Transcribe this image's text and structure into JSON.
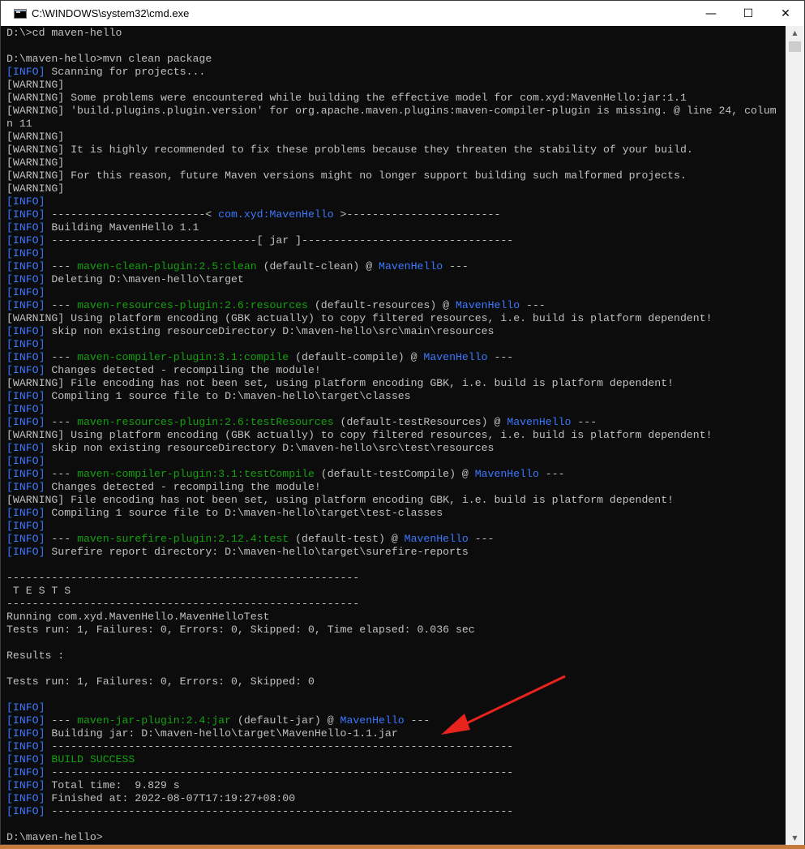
{
  "window": {
    "title": "C:\\WINDOWS\\system32\\cmd.exe",
    "controls": {
      "minimize": "—",
      "maximize": "☐",
      "close": "✕"
    }
  },
  "colors": {
    "info": "#3b78ff",
    "green": "#13a10e",
    "text": "#c0c0c0",
    "arrow": "#e8231e"
  },
  "console": {
    "lines": [
      [
        {
          "t": "D:\\>cd maven-hello"
        }
      ],
      [
        {
          "t": ""
        }
      ],
      [
        {
          "t": "D:\\maven-hello>mvn clean package"
        }
      ],
      [
        {
          "t": "[INFO]",
          "c": "info"
        },
        {
          "t": " Scanning for projects..."
        }
      ],
      [
        {
          "t": "[WARNING]"
        }
      ],
      [
        {
          "t": "[WARNING]"
        },
        {
          "t": " Some problems were encountered while building the effective model for com.xyd:MavenHello:jar:1.1"
        }
      ],
      [
        {
          "t": "[WARNING]"
        },
        {
          "t": " 'build.plugins.plugin.version' for org.apache.maven.plugins:maven-compiler-plugin is missing. @ line 24, colum"
        }
      ],
      [
        {
          "t": "n 11"
        }
      ],
      [
        {
          "t": "[WARNING]"
        }
      ],
      [
        {
          "t": "[WARNING]"
        },
        {
          "t": " It is highly recommended to fix these problems because they threaten the stability of your build."
        }
      ],
      [
        {
          "t": "[WARNING]"
        }
      ],
      [
        {
          "t": "[WARNING]"
        },
        {
          "t": " For this reason, future Maven versions might no longer support building such malformed projects."
        }
      ],
      [
        {
          "t": "[WARNING]"
        }
      ],
      [
        {
          "t": "[INFO]",
          "c": "info"
        }
      ],
      [
        {
          "t": "[INFO]",
          "c": "info"
        },
        {
          "t": " ------------------------< "
        },
        {
          "t": "com.xyd:MavenHello",
          "c": "blue"
        },
        {
          "t": " >------------------------"
        }
      ],
      [
        {
          "t": "[INFO]",
          "c": "info"
        },
        {
          "t": " Building MavenHello 1.1"
        }
      ],
      [
        {
          "t": "[INFO]",
          "c": "info"
        },
        {
          "t": " --------------------------------[ jar ]---------------------------------"
        }
      ],
      [
        {
          "t": "[INFO]",
          "c": "info"
        }
      ],
      [
        {
          "t": "[INFO]",
          "c": "info"
        },
        {
          "t": " --- "
        },
        {
          "t": "maven-clean-plugin:2.5:clean",
          "c": "green"
        },
        {
          "t": " (default-clean) @ "
        },
        {
          "t": "MavenHello",
          "c": "blue"
        },
        {
          "t": " ---"
        }
      ],
      [
        {
          "t": "[INFO]",
          "c": "info"
        },
        {
          "t": " Deleting D:\\maven-hello\\target"
        }
      ],
      [
        {
          "t": "[INFO]",
          "c": "info"
        }
      ],
      [
        {
          "t": "[INFO]",
          "c": "info"
        },
        {
          "t": " --- "
        },
        {
          "t": "maven-resources-plugin:2.6:resources",
          "c": "green"
        },
        {
          "t": " (default-resources) @ "
        },
        {
          "t": "MavenHello",
          "c": "blue"
        },
        {
          "t": " ---"
        }
      ],
      [
        {
          "t": "[WARNING]"
        },
        {
          "t": " Using platform encoding (GBK actually) to copy filtered resources, i.e. build is platform dependent!"
        }
      ],
      [
        {
          "t": "[INFO]",
          "c": "info"
        },
        {
          "t": " skip non existing resourceDirectory D:\\maven-hello\\src\\main\\resources"
        }
      ],
      [
        {
          "t": "[INFO]",
          "c": "info"
        }
      ],
      [
        {
          "t": "[INFO]",
          "c": "info"
        },
        {
          "t": " --- "
        },
        {
          "t": "maven-compiler-plugin:3.1:compile",
          "c": "green"
        },
        {
          "t": " (default-compile) @ "
        },
        {
          "t": "MavenHello",
          "c": "blue"
        },
        {
          "t": " ---"
        }
      ],
      [
        {
          "t": "[INFO]",
          "c": "info"
        },
        {
          "t": " Changes detected - recompiling the module!"
        }
      ],
      [
        {
          "t": "[WARNING]"
        },
        {
          "t": " File encoding has not been set, using platform encoding GBK, i.e. build is platform dependent!"
        }
      ],
      [
        {
          "t": "[INFO]",
          "c": "info"
        },
        {
          "t": " Compiling 1 source file to D:\\maven-hello\\target\\classes"
        }
      ],
      [
        {
          "t": "[INFO]",
          "c": "info"
        }
      ],
      [
        {
          "t": "[INFO]",
          "c": "info"
        },
        {
          "t": " --- "
        },
        {
          "t": "maven-resources-plugin:2.6:testResources",
          "c": "green"
        },
        {
          "t": " (default-testResources) @ "
        },
        {
          "t": "MavenHello",
          "c": "blue"
        },
        {
          "t": " ---"
        }
      ],
      [
        {
          "t": "[WARNING]"
        },
        {
          "t": " Using platform encoding (GBK actually) to copy filtered resources, i.e. build is platform dependent!"
        }
      ],
      [
        {
          "t": "[INFO]",
          "c": "info"
        },
        {
          "t": " skip non existing resourceDirectory D:\\maven-hello\\src\\test\\resources"
        }
      ],
      [
        {
          "t": "[INFO]",
          "c": "info"
        }
      ],
      [
        {
          "t": "[INFO]",
          "c": "info"
        },
        {
          "t": " --- "
        },
        {
          "t": "maven-compiler-plugin:3.1:testCompile",
          "c": "green"
        },
        {
          "t": " (default-testCompile) @ "
        },
        {
          "t": "MavenHello",
          "c": "blue"
        },
        {
          "t": " ---"
        }
      ],
      [
        {
          "t": "[INFO]",
          "c": "info"
        },
        {
          "t": " Changes detected - recompiling the module!"
        }
      ],
      [
        {
          "t": "[WARNING]"
        },
        {
          "t": " File encoding has not been set, using platform encoding GBK, i.e. build is platform dependent!"
        }
      ],
      [
        {
          "t": "[INFO]",
          "c": "info"
        },
        {
          "t": " Compiling 1 source file to D:\\maven-hello\\target\\test-classes"
        }
      ],
      [
        {
          "t": "[INFO]",
          "c": "info"
        }
      ],
      [
        {
          "t": "[INFO]",
          "c": "info"
        },
        {
          "t": " --- "
        },
        {
          "t": "maven-surefire-plugin:2.12.4:test",
          "c": "green"
        },
        {
          "t": " (default-test) @ "
        },
        {
          "t": "MavenHello",
          "c": "blue"
        },
        {
          "t": " ---"
        }
      ],
      [
        {
          "t": "[INFO]",
          "c": "info"
        },
        {
          "t": " Surefire report directory: D:\\maven-hello\\target\\surefire-reports"
        }
      ],
      [
        {
          "t": ""
        }
      ],
      [
        {
          "t": "-------------------------------------------------------"
        }
      ],
      [
        {
          "t": " T E S T S"
        }
      ],
      [
        {
          "t": "-------------------------------------------------------"
        }
      ],
      [
        {
          "t": "Running com.xyd.MavenHello.MavenHelloTest"
        }
      ],
      [
        {
          "t": "Tests run: 1, Failures: 0, Errors: 0, Skipped: 0, Time elapsed: 0.036 sec"
        }
      ],
      [
        {
          "t": ""
        }
      ],
      [
        {
          "t": "Results :"
        }
      ],
      [
        {
          "t": ""
        }
      ],
      [
        {
          "t": "Tests run: 1, Failures: 0, Errors: 0, Skipped: 0"
        }
      ],
      [
        {
          "t": ""
        }
      ],
      [
        {
          "t": "[INFO]",
          "c": "info"
        }
      ],
      [
        {
          "t": "[INFO]",
          "c": "info"
        },
        {
          "t": " --- "
        },
        {
          "t": "maven-jar-plugin:2.4:jar",
          "c": "green"
        },
        {
          "t": " (default-jar) @ "
        },
        {
          "t": "MavenHello",
          "c": "blue"
        },
        {
          "t": " ---"
        }
      ],
      [
        {
          "t": "[INFO]",
          "c": "info"
        },
        {
          "t": " Building jar: D:\\maven-hello\\target\\MavenHello-1.1.jar"
        }
      ],
      [
        {
          "t": "[INFO]",
          "c": "info"
        },
        {
          "t": " ------------------------------------------------------------------------"
        }
      ],
      [
        {
          "t": "[INFO]",
          "c": "info"
        },
        {
          "t": " "
        },
        {
          "t": "BUILD SUCCESS",
          "c": "green"
        }
      ],
      [
        {
          "t": "[INFO]",
          "c": "info"
        },
        {
          "t": " ------------------------------------------------------------------------"
        }
      ],
      [
        {
          "t": "[INFO]",
          "c": "info"
        },
        {
          "t": " Total time:  9.829 s"
        }
      ],
      [
        {
          "t": "[INFO]",
          "c": "info"
        },
        {
          "t": " Finished at: 2022-08-07T17:19:27+08:00"
        }
      ],
      [
        {
          "t": "[INFO]",
          "c": "info"
        },
        {
          "t": " ------------------------------------------------------------------------"
        }
      ],
      [
        {
          "t": ""
        }
      ],
      [
        {
          "t": "D:\\maven-hello>"
        }
      ]
    ]
  }
}
